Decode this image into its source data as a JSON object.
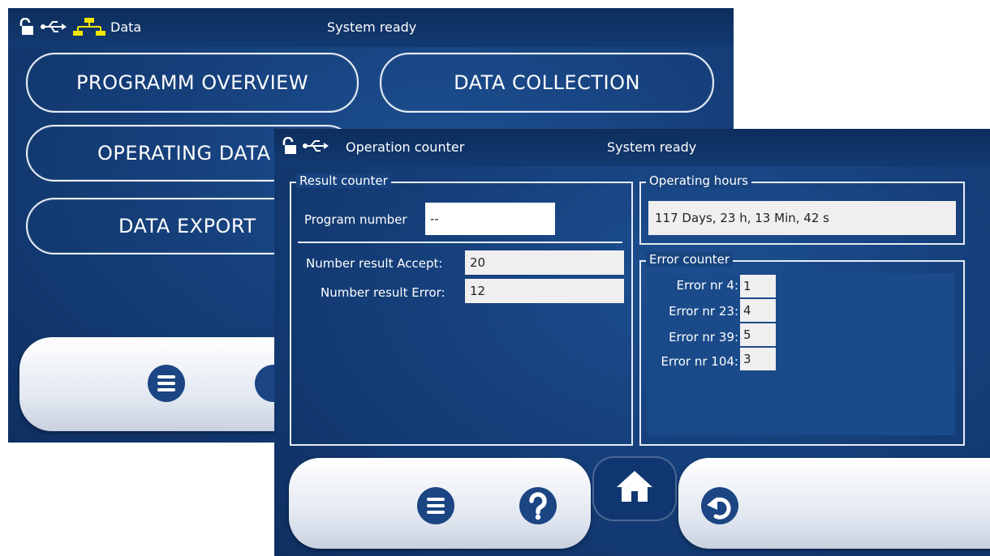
{
  "back_screen": {
    "status_bar": {
      "title": "Data",
      "status": "System ready",
      "icons": [
        "unlock-icon",
        "usb-icon",
        "network-icon"
      ]
    },
    "buttons": {
      "programm_overview": "PROGRAMM OVERVIEW",
      "data_collection": "DATA COLLECTION",
      "operating_data": "OPERATING DATA",
      "data_export": "DATA EXPORT"
    }
  },
  "front_screen": {
    "status_bar": {
      "title": "Operation counter",
      "status": "System ready",
      "icons": [
        "unlock-icon",
        "usb-icon"
      ]
    },
    "result_counter": {
      "title": "Result counter",
      "program_number_label": "Program number",
      "program_number_value": "--",
      "accept_label": "Number result Accept:",
      "accept_value": "20",
      "error_label": "Number result Error:",
      "error_value": "12"
    },
    "operating_hours": {
      "title": "Operating hours",
      "value": "117 Days, 23 h, 13 Min, 42 s"
    },
    "error_counter": {
      "title": "Error counter",
      "rows": [
        {
          "label": "Error nr  4:",
          "value": "1"
        },
        {
          "label": "Error nr  23:",
          "value": "4"
        },
        {
          "label": "Error nr  39:",
          "value": "5"
        },
        {
          "label": "Error nr  104:",
          "value": "3"
        }
      ]
    },
    "bottom_bar": {
      "icons": [
        "menu-icon",
        "help-icon",
        "home-icon",
        "back-icon"
      ]
    }
  },
  "colors": {
    "screen_bg": "#16407c",
    "statusbar_bg": "#0d2d5c",
    "network_icon": "#f2e600",
    "field_bg": "#efefef"
  }
}
